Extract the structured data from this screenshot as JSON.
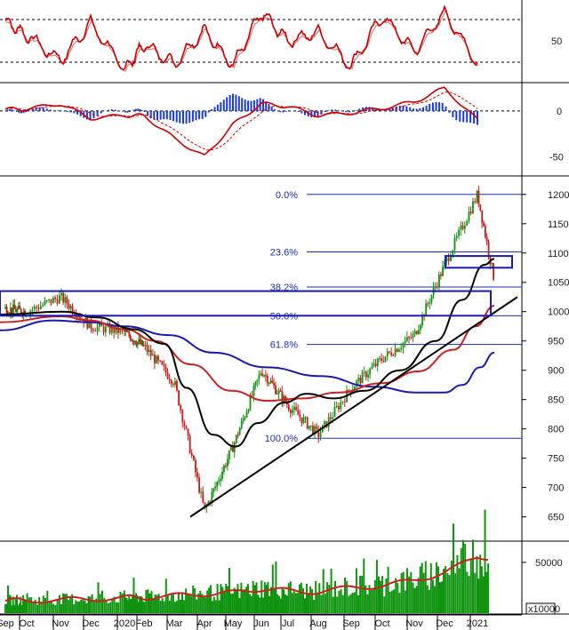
{
  "chart_data": [
    {
      "type": "line",
      "panel": "stochastic",
      "ylim": [
        0,
        100
      ],
      "y_ticks": [
        "50"
      ],
      "reference_lines": [
        80,
        20
      ],
      "colors": {
        "fast": "#cc0000",
        "slow": "#cc0000"
      },
      "x": [
        "Sep",
        "Oct",
        "Nov",
        "Dec",
        "2020",
        "Feb",
        "Mar",
        "Apr",
        "May",
        "Jun",
        "Jul",
        "Aug",
        "Sep",
        "Oct",
        "Nov",
        "Dec",
        "2021"
      ],
      "series": [
        {
          "values": [
            78,
            58,
            22,
            75,
            10,
            45,
            18,
            65,
            15,
            90,
            50,
            62,
            15,
            85,
            35,
            90,
            18
          ]
        }
      ]
    },
    {
      "type": "line",
      "panel": "macd",
      "ylim": [
        -70,
        30
      ],
      "y_ticks": [
        "0",
        "-50"
      ],
      "colors": {
        "macd": "#cc0000",
        "signal": "#cc0000",
        "histogram": "#1a3cdc"
      },
      "x": [
        "Sep",
        "Oct",
        "Nov",
        "Dec",
        "2020",
        "Feb",
        "Mar",
        "Apr",
        "May",
        "Jun",
        "Jul",
        "Aug",
        "Sep",
        "Oct",
        "Nov",
        "Dec",
        "2021"
      ],
      "series": [
        {
          "values": [
            2,
            2,
            8,
            -8,
            -5,
            -5,
            -30,
            -50,
            -15,
            8,
            5,
            -5,
            -2,
            3,
            10,
            25,
            -10
          ]
        }
      ]
    },
    {
      "type": "line",
      "panel": "price",
      "ylim": [
        610,
        1230
      ],
      "y_ticks": [
        "1200",
        "1150",
        "1100",
        "1050",
        "1000",
        "950",
        "900",
        "850",
        "800",
        "750",
        "700",
        "650"
      ],
      "x": [
        "Sep",
        "Oct",
        "Nov",
        "Dec",
        "2020",
        "Feb",
        "Mar",
        "Apr",
        "May",
        "Jun",
        "Jul",
        "Aug",
        "Sep",
        "Oct",
        "Nov",
        "Dec",
        "2021"
      ],
      "fibonacci": [
        {
          "label": "0.0%",
          "value": 1200
        },
        {
          "label": "23.6%",
          "value": 1102
        },
        {
          "label": "38.2%",
          "value": 1042
        },
        {
          "label": "50.0%",
          "value": 993
        },
        {
          "label": "61.8%",
          "value": 944
        },
        {
          "label": "100.0%",
          "value": 784
        }
      ],
      "colors": {
        "price": "#109410",
        "down": "#d01818",
        "ma_black": "#000000",
        "ma_red": "#cc2020",
        "ma_blue": "#1a1ab0",
        "fib": "#1a2fb0"
      },
      "series": [
        {
          "values": [
            1005,
            1000,
            1025,
            975,
            965,
            940,
            880,
            660,
            770,
            900,
            840,
            790,
            870,
            920,
            960,
            1080,
            1200,
            1060
          ]
        }
      ]
    },
    {
      "type": "bar",
      "panel": "volume",
      "unit_label": "x10000",
      "y_ticks": [
        "50000"
      ],
      "colors": {
        "bars": "#109410",
        "ma": "#cc2020"
      },
      "x": [
        "Sep",
        "Oct",
        "Nov",
        "Dec",
        "2020",
        "Feb",
        "Mar",
        "Apr",
        "May",
        "Jun",
        "Jul",
        "Aug",
        "Sep",
        "Oct",
        "Nov",
        "Dec",
        "2021"
      ],
      "series": [
        {
          "values": [
            12000,
            12500,
            13000,
            14000,
            15000,
            15500,
            17000,
            19000,
            20000,
            24000,
            22000,
            21000,
            25000,
            27000,
            32000,
            40000,
            55000
          ]
        }
      ]
    }
  ]
}
